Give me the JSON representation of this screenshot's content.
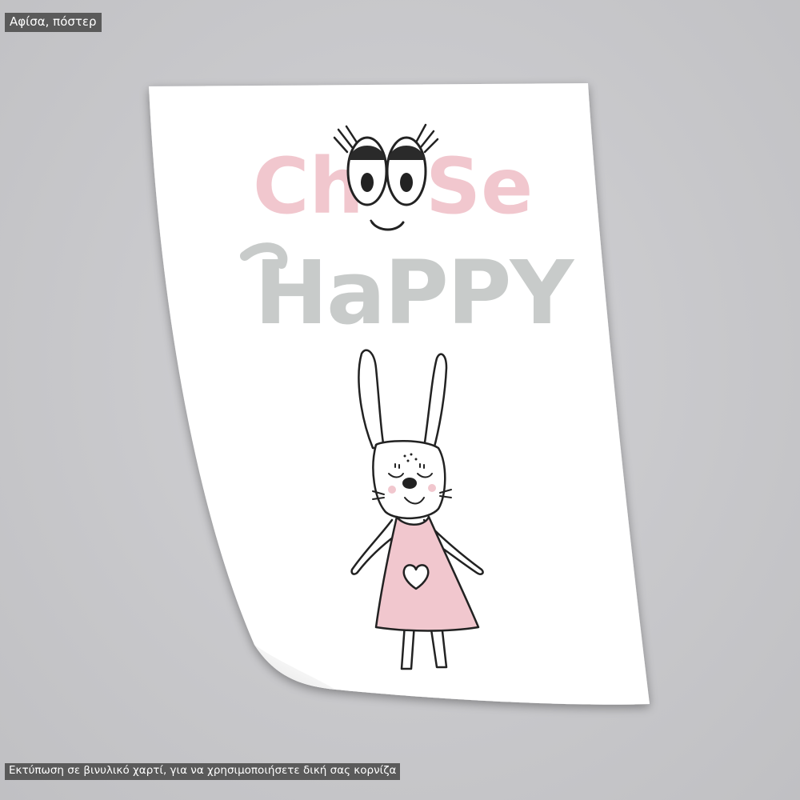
{
  "labels": {
    "category": "Αφίσα, πόστερ",
    "note": "Εκτύπωση σε βινυλικό χαρτί, για να χρησιμοποιήσετε δική σας κορνίζα"
  },
  "poster": {
    "line1_part1": "Ch",
    "line1_part2": "Se",
    "line2": "HaPPY"
  },
  "colors": {
    "background": "#c9c9cc",
    "paper": "#ffffff",
    "pink": "#f1c7ce",
    "grey_text": "#c8cbca",
    "ink": "#222222",
    "label_bg": "#5a5a5a"
  }
}
